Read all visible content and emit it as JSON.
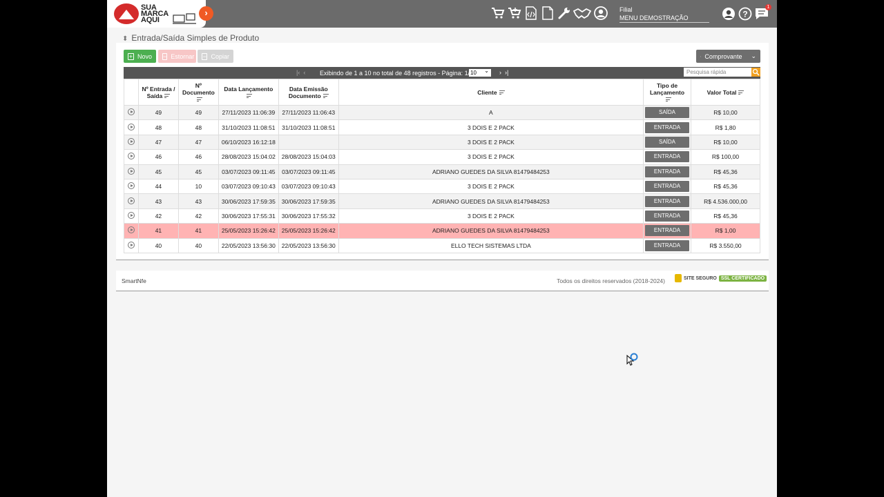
{
  "brand": {
    "logo_text": [
      "SUA",
      "MARCA",
      "AQUI"
    ]
  },
  "header": {
    "filial_label": "Filial",
    "filial_value": "MENU DEMOSTRAÇÃO",
    "notification_count": "1"
  },
  "page": {
    "title": "Entrada/Saída Simples de Produto"
  },
  "toolbar": {
    "novo": "Novo",
    "estornar": "Estornar",
    "copiar": "Copiar",
    "comprovante": "Comprovante"
  },
  "pager": {
    "info": "Exibindo de 1 a 10 no total de 48 registros - Página: 1/5",
    "page_size": "10",
    "search_placeholder": "Pesquisa rápida"
  },
  "table": {
    "columns": [
      "Nº Entrada / Saída",
      "Nº Documento",
      "Data Lançamento",
      "Data Emissão Documento",
      "Cliente",
      "Tipo de Lançamento",
      "Valor Total"
    ],
    "rows": [
      [
        "49",
        "49",
        "27/11/2023 11:06:39",
        "27/11/2023 11:06:43",
        "A",
        "SAÍDA",
        "R$ 10,00"
      ],
      [
        "48",
        "48",
        "31/10/2023 11:08:51",
        "31/10/2023 11:08:51",
        "3 DOIS E 2 PACK",
        "ENTRADA",
        "R$ 1,80"
      ],
      [
        "47",
        "47",
        "06/10/2023 16:12:18",
        "",
        "3 DOIS E 2 PACK",
        "SAÍDA",
        "R$ 10,00"
      ],
      [
        "46",
        "46",
        "28/08/2023 15:04:02",
        "28/08/2023 15:04:03",
        "3 DOIS E 2 PACK",
        "ENTRADA",
        "R$ 100,00"
      ],
      [
        "45",
        "45",
        "03/07/2023 09:11:45",
        "03/07/2023 09:11:45",
        "ADRIANO GUEDES DA SILVA 81479484253",
        "ENTRADA",
        "R$ 45,36"
      ],
      [
        "44",
        "10",
        "03/07/2023 09:10:43",
        "03/07/2023 09:10:43",
        "3 DOIS E 2 PACK",
        "ENTRADA",
        "R$ 45,36"
      ],
      [
        "43",
        "43",
        "30/06/2023 17:59:35",
        "30/06/2023 17:59:35",
        "ADRIANO GUEDES DA SILVA 81479484253",
        "ENTRADA",
        "R$ 4.536.000,00"
      ],
      [
        "42",
        "42",
        "30/06/2023 17:55:31",
        "30/06/2023 17:55:32",
        "3 DOIS E 2 PACK",
        "ENTRADA",
        "R$ 45,36"
      ],
      [
        "41",
        "41",
        "25/05/2023 15:26:42",
        "25/05/2023 15:26:42",
        "ADRIANO GUEDES DA SILVA 81479484253",
        "ENTRADA",
        "R$ 1,00"
      ],
      [
        "40",
        "40",
        "22/05/2023 13:56:30",
        "22/05/2023 13:56:30",
        "ELLO TECH SISTEMAS LTDA",
        "ENTRADA",
        "R$ 3.550,00"
      ]
    ],
    "highlight_row": 8
  },
  "footer": {
    "left": "SmartNfe",
    "right": "Todos os direitos reservados (2018-2024)",
    "ssl_label": "SITE SEGURO",
    "ssl_badge": "SSL CERTIFICADO"
  }
}
